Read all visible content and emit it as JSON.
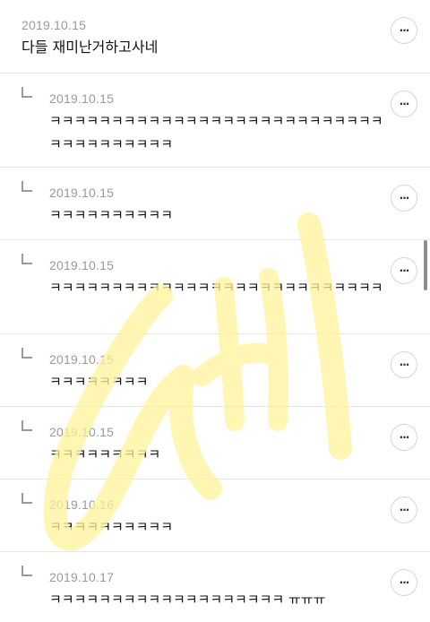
{
  "comments": [
    {
      "date": "2019.10.15",
      "text": "다들 재미난거하고사네",
      "reply": false,
      "more": "···"
    },
    {
      "date": "2019.10.15",
      "text": "ㅋㅋㅋㅋㅋㅋㅋㅋㅋㅋㅋㅋㅋㅋㅋㅋㅋㅋㅋㅋㅋㅋㅋㅋㅋㅋㅋㅋㅋㅋㅋㅋㅋㅋㅋㅋㅋ",
      "reply": true,
      "more": "···"
    },
    {
      "date": "2019.10.15",
      "text": "ㅋㅋㅋㅋㅋㅋㅋㅋㅋㅋ",
      "reply": true,
      "more": "···"
    },
    {
      "date": "2019.10.15",
      "text": "ㅋㅋㅋㅋㅋㅋㅋㅋㅋㅋㅋㅋㅋㅋㅋㅋㅋㅋㅋㅋㅋㅋㅋㅋㅋㅋㅋ",
      "reply": true,
      "more": "···"
    },
    {
      "date": "2019.10.15",
      "text": "ㅋㅋㅋㅋㅋㅋㅋㅋ",
      "reply": true,
      "more": "···"
    },
    {
      "date": "2019.10.15",
      "text": "ㅋㅋㅋㅋㅋㅋㅋㅋㅋ",
      "reply": true,
      "more": "···"
    },
    {
      "date": "2019.10.16",
      "text": "ㅋㅋㅋㅋㅋㅋㅋㅋㅋㅋ",
      "reply": true,
      "more": "···"
    },
    {
      "date": "2019.10.17",
      "text": "ㅋㅋㅋㅋㅋㅋㅋㅋㅋㅋㅋㅋㅋㅋㅋㅋㅋㅋㅋ ㅠㅠㅠ",
      "reply": true,
      "more": "···"
    }
  ],
  "colors": {
    "watermark": "#fff39a",
    "date": "#9a9a9a",
    "divider": "#e6e6e6"
  }
}
